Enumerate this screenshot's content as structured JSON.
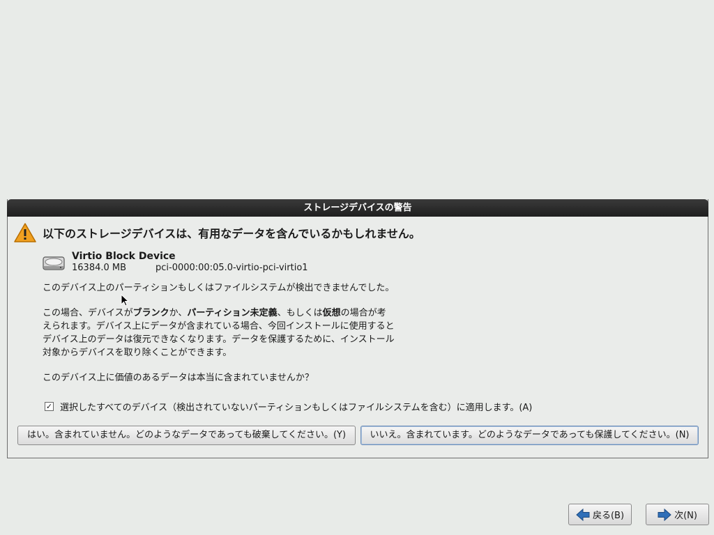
{
  "dialog": {
    "title": "ストレージデバイスの警告",
    "headline": "以下のストレージデバイスは、有用なデータを含んでいるかもしれません。",
    "device": {
      "name": "Virtio Block Device",
      "size": "16384.0 MB",
      "path": "pci-0000:00:05.0-virtio-pci-virtio1"
    },
    "paragraph1": "このデバイス上のパーティションもしくはファイルシステムが検出できませんでした。",
    "paragraph2": {
      "line1_a": "この場合、デバイスが",
      "line1_b": "ブランク",
      "line1_c": "か、",
      "line1_d": "パーティション未定義",
      "line1_e": "、もしくは",
      "line1_f": "仮想",
      "line1_g": "の場合が考",
      "line2": "えられます。デバイス上にデータが含まれている場合、今回インストールに使用すると",
      "line3": "デバイス上のデータは復元できなくなります。データを保護するために、インストール",
      "line4": "対象からデバイスを取り除くことができます。"
    },
    "question": "このデバイス上に価値のあるデータは本当に含まれていませんか？",
    "apply_all_label": "選択したすべてのデバイス（検出されていないパーティションもしくはファイルシステムを含む）に適用します。(A)",
    "apply_all_checked": true,
    "yes_button": "はい。含まれていません。どのようなデータであっても破棄してください。(Y)",
    "no_button": "いいえ。含まれています。どのようなデータであっても保護してください。(N)"
  },
  "nav": {
    "back_label": "戻る(B)",
    "next_label": "次(N)"
  },
  "colors": {
    "background": "#e8ebe8",
    "titlebar": "#262626",
    "warning": "#f0a020",
    "arrow": "#2f6fb8"
  }
}
